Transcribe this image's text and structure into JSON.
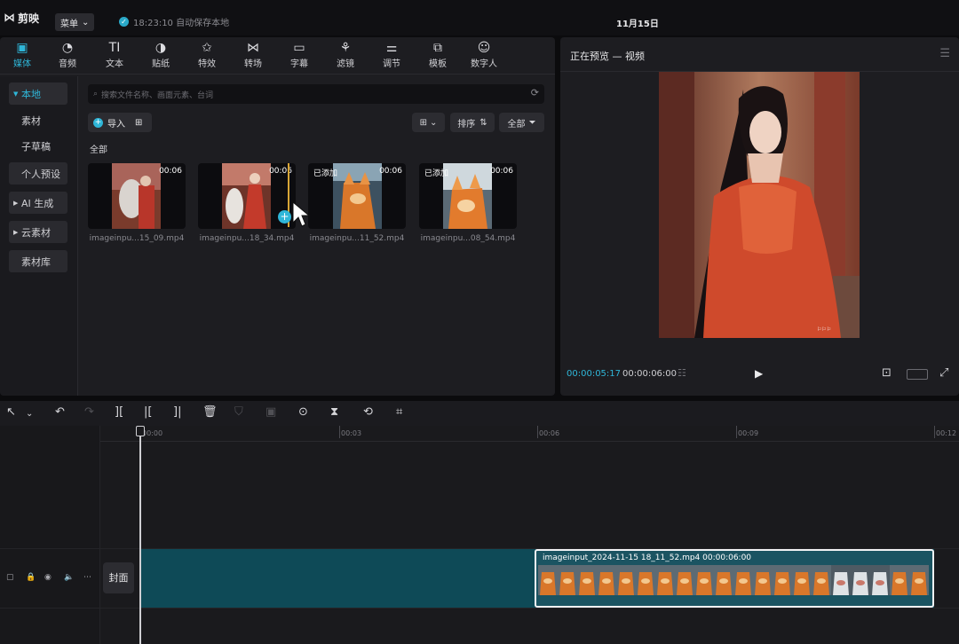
{
  "app": {
    "logo": "剪映",
    "menu_label": "菜单",
    "autosave": "18:23:10 自动保存本地",
    "date": "11月15日"
  },
  "toolbar_tabs": [
    {
      "label": "媒体",
      "icon": "media-icon",
      "glyph": "▣"
    },
    {
      "label": "音频",
      "icon": "audio-icon",
      "glyph": "◔"
    },
    {
      "label": "文本",
      "icon": "text-icon",
      "glyph": "TI"
    },
    {
      "label": "贴纸",
      "icon": "sticker-icon",
      "glyph": "◑"
    },
    {
      "label": "特效",
      "icon": "effects-icon",
      "glyph": "✩"
    },
    {
      "label": "转场",
      "icon": "transition-icon",
      "glyph": "⋈"
    },
    {
      "label": "字幕",
      "icon": "subtitle-icon",
      "glyph": "▭"
    },
    {
      "label": "滤镜",
      "icon": "filter-icon",
      "glyph": "⚘"
    },
    {
      "label": "调节",
      "icon": "adjust-icon",
      "glyph": "⚌"
    },
    {
      "label": "模板",
      "icon": "template-icon",
      "glyph": "⧉"
    },
    {
      "label": "数字人",
      "icon": "avatar-icon",
      "glyph": "☺"
    }
  ],
  "sidebar": [
    {
      "label": "本地",
      "arrow": true
    },
    {
      "label": "素材",
      "arrow": false
    },
    {
      "label": "子草稿",
      "arrow": false
    },
    {
      "label": "个人预设",
      "arrow": false
    },
    {
      "label": "AI 生成",
      "arrow": true
    },
    {
      "label": "云素材",
      "arrow": true
    },
    {
      "label": "素材库",
      "arrow": false
    }
  ],
  "media": {
    "search_placeholder": "搜索文件名称、画面元素、台词",
    "import_label": "导入",
    "sort_label": "排序",
    "filter_label": "全部",
    "section_label": "全部",
    "clips": [
      {
        "name": "imageinpu...15_09.mp4",
        "duration": "00:06",
        "added": ""
      },
      {
        "name": "imageinpu...18_34.mp4",
        "duration": "00:06",
        "added": ""
      },
      {
        "name": "imageinpu...11_52.mp4",
        "duration": "00:06",
        "added": "已添加"
      },
      {
        "name": "imageinpu...08_54.mp4",
        "duration": "00:06",
        "added": "已添加"
      }
    ]
  },
  "preview": {
    "title": "正在预览 — 视频",
    "current_time": "00:00:05:17",
    "total_time": "00:00:06:00"
  },
  "timeline": {
    "ticks": [
      "00:00",
      "00:03",
      "00:06",
      "00:09",
      "00:12"
    ],
    "cover_label": "封面",
    "clip_label": "imageinput_2024-11-15 18_11_52.mp4   00:00:06:00"
  }
}
